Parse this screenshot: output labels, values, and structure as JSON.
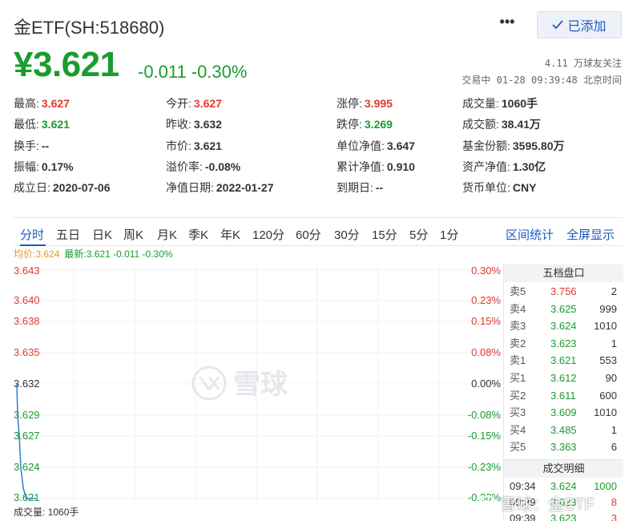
{
  "header": {
    "title": "金ETF(SH:518680)",
    "more_icon": "ellipsis-icon",
    "add_label": "已添加",
    "price": "¥3.621",
    "change": "-0.011",
    "change_pct": "-0.30%",
    "followers": "4.11 万球友关注",
    "status": "交易中 01-28 09:39:48 北京时间"
  },
  "stats": [
    [
      {
        "label": "最高:",
        "value": "3.627",
        "tone": "up"
      },
      {
        "label": "今开:",
        "value": "3.627",
        "tone": "up"
      },
      {
        "label": "涨停:",
        "value": "3.995",
        "tone": "red"
      },
      {
        "label": "成交量:",
        "value": "1060手",
        "tone": "neutral"
      }
    ],
    [
      {
        "label": "最低:",
        "value": "3.621",
        "tone": "down"
      },
      {
        "label": "昨收:",
        "value": "3.632",
        "tone": "neutral"
      },
      {
        "label": "跌停:",
        "value": "3.269",
        "tone": "down"
      },
      {
        "label": "成交额:",
        "value": "38.41万",
        "tone": "neutral"
      }
    ],
    [
      {
        "label": "换手:",
        "value": "--",
        "tone": "neutral"
      },
      {
        "label": "市价:",
        "value": "3.621",
        "tone": "neutral"
      },
      {
        "label": "单位净值:",
        "value": "3.647",
        "tone": "neutral"
      },
      {
        "label": "基金份额:",
        "value": "3595.80万",
        "tone": "neutral"
      }
    ],
    [
      {
        "label": "振幅:",
        "value": "0.17%",
        "tone": "neutral"
      },
      {
        "label": "溢价率:",
        "value": "-0.08%",
        "tone": "neutral"
      },
      {
        "label": "累计净值:",
        "value": "0.910",
        "tone": "neutral"
      },
      {
        "label": "资产净值:",
        "value": "1.30亿",
        "tone": "neutral"
      }
    ],
    [
      {
        "label": "成立日:",
        "value": "2020-07-06",
        "tone": "neutral"
      },
      {
        "label": "净值日期:",
        "value": "2022-01-27",
        "tone": "neutral"
      },
      {
        "label": "到期日:",
        "value": "--",
        "tone": "neutral"
      },
      {
        "label": "货币单位:",
        "value": "CNY",
        "tone": "neutral"
      }
    ]
  ],
  "tabs": [
    "分时",
    "五日",
    "日K",
    "周K",
    "月K",
    "季K",
    "年K",
    "120分",
    "60分",
    "30分",
    "15分",
    "5分",
    "1分"
  ],
  "tabs_right": [
    "区间统计",
    "全屏显示"
  ],
  "chart_info": {
    "avg": "均价:3.624",
    "latest": "最新:3.621 -0.011 -0.30%"
  },
  "colors": {
    "up": "#e03a2f",
    "down": "#1a9c2e",
    "accent": "#1d5bbf",
    "avg_line": "#e69b1f"
  },
  "chart_data": {
    "type": "line",
    "title": "",
    "y_ticks": [
      "3.643",
      "3.640",
      "3.638",
      "3.635",
      "3.632",
      "3.629",
      "3.627",
      "3.624",
      "3.621"
    ],
    "y_pct_ticks": [
      "0.30%",
      "0.23%",
      "0.15%",
      "0.08%",
      "0.00%",
      "-0.08%",
      "-0.15%",
      "-0.23%",
      "-0.30%"
    ],
    "ylim": [
      3.621,
      3.643
    ],
    "base_price": 3.632,
    "series": [
      {
        "values": [
          3.632,
          3.629,
          3.627,
          3.624,
          3.622,
          3.621,
          3.621
        ]
      }
    ],
    "watermark": "雪球"
  },
  "volume_label": "成交量: 1060手",
  "order_book": {
    "title": "五档盘口",
    "asks": [
      {
        "label": "卖5",
        "price": "3.756",
        "vol": "2",
        "tone": "up"
      },
      {
        "label": "卖4",
        "price": "3.625",
        "vol": "999",
        "tone": "down"
      },
      {
        "label": "卖3",
        "price": "3.624",
        "vol": "1010",
        "tone": "down"
      },
      {
        "label": "卖2",
        "price": "3.623",
        "vol": "1",
        "tone": "down"
      },
      {
        "label": "卖1",
        "price": "3.621",
        "vol": "553",
        "tone": "down"
      }
    ],
    "bids": [
      {
        "label": "买1",
        "price": "3.612",
        "vol": "90",
        "tone": "down"
      },
      {
        "label": "买2",
        "price": "3.611",
        "vol": "600",
        "tone": "down"
      },
      {
        "label": "买3",
        "price": "3.609",
        "vol": "1010",
        "tone": "down"
      },
      {
        "label": "买4",
        "price": "3.485",
        "vol": "1",
        "tone": "down"
      },
      {
        "label": "买5",
        "price": "3.363",
        "vol": "6",
        "tone": "down"
      }
    ],
    "trades_title": "成交明细",
    "trades": [
      {
        "time": "09:34",
        "price": "3.624",
        "vol": "1000",
        "tone": "down"
      },
      {
        "time": "09:39",
        "price": "3.623",
        "vol": "8",
        "tone": "down"
      },
      {
        "time": "09:39",
        "price": "3.623",
        "vol": "3",
        "tone": "down"
      }
    ]
  },
  "footer_watermark": "雪球：金ETF"
}
